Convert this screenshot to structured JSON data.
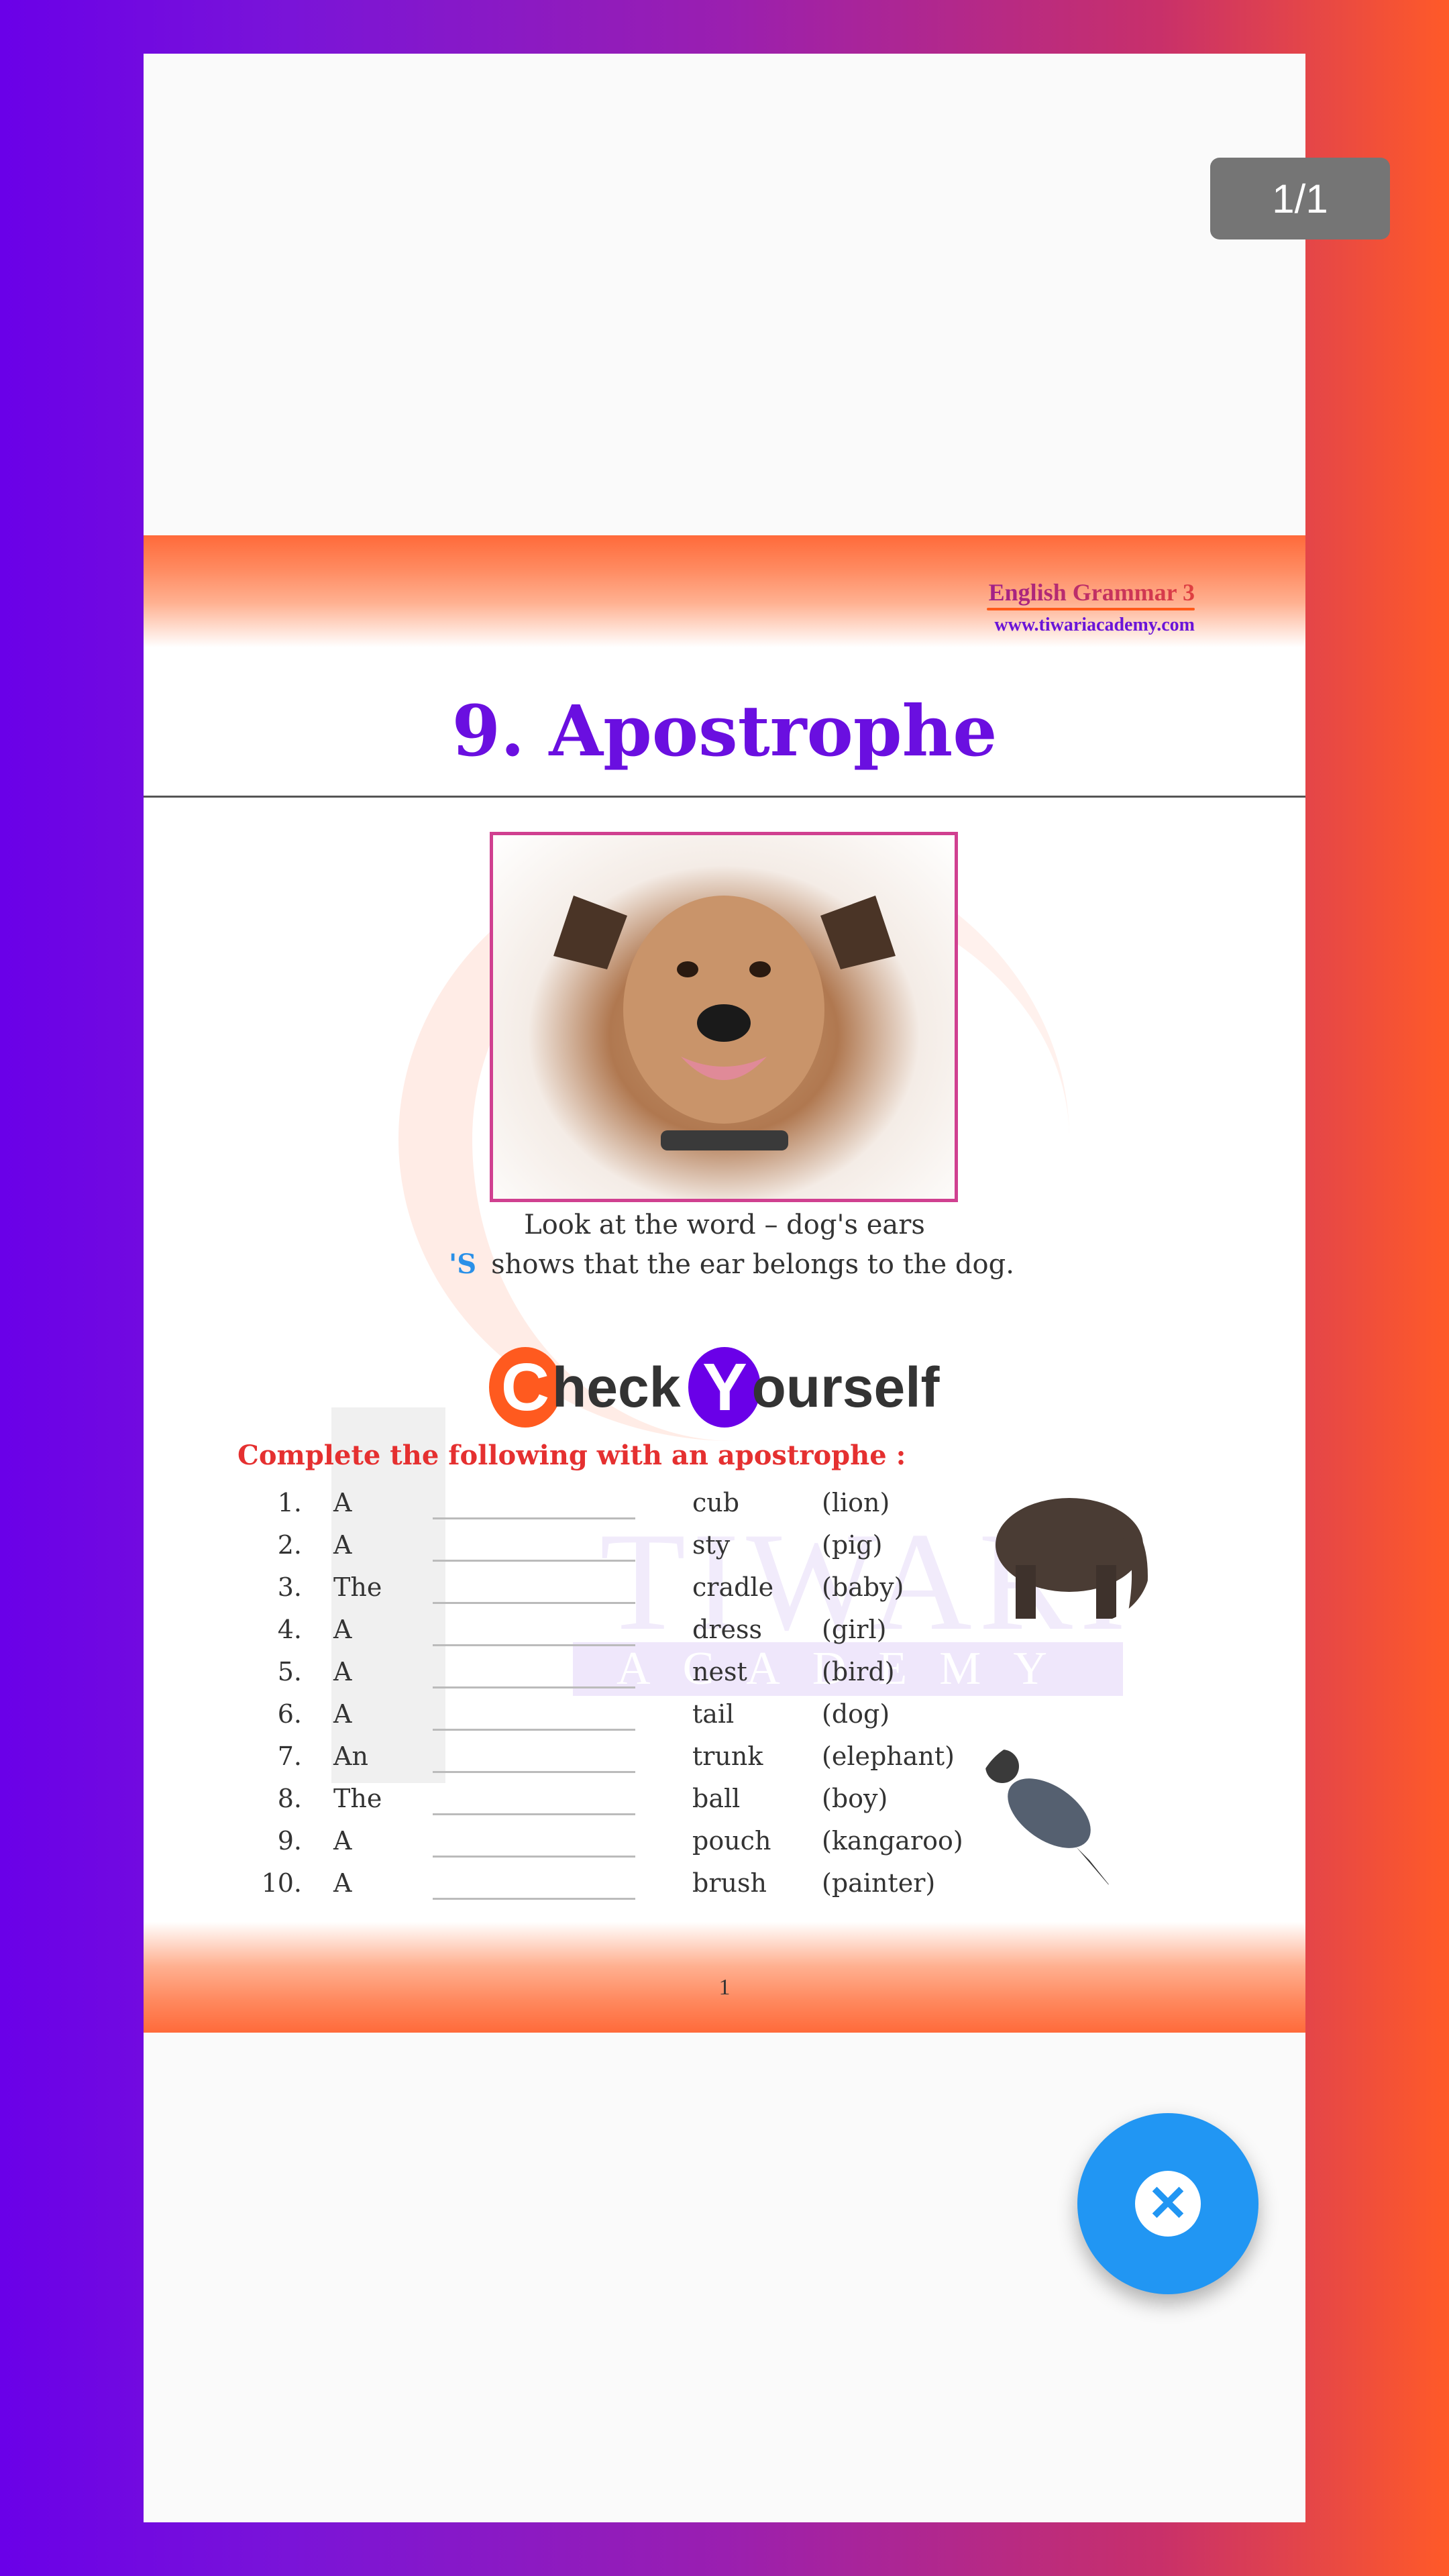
{
  "viewer": {
    "page_indicator": "1/1",
    "close_icon": "close-circle-icon"
  },
  "page": {
    "header": {
      "book": "English Grammar 3",
      "website": "www.tiwariacademy.com"
    },
    "title": "9. Apostrophe",
    "caption_line1": "Look at the word  –  dog's ears",
    "caption_marker": "'S",
    "caption_line2": "shows that the ear belongs to the dog.",
    "check_yourself": {
      "c": "C",
      "heck": "heck",
      "y": "Y",
      "ourself": "ourself"
    },
    "instruction": "Complete the following with an apostrophe :",
    "exercises": [
      {
        "num": "1.",
        "article": "A",
        "noun": "cub",
        "owner": "(lion)"
      },
      {
        "num": "2.",
        "article": "A",
        "noun": "sty",
        "owner": "(pig)"
      },
      {
        "num": "3.",
        "article": "The",
        "noun": "cradle",
        "owner": "(baby)"
      },
      {
        "num": "4.",
        "article": "A",
        "noun": "dress",
        "owner": "(girl)"
      },
      {
        "num": "5.",
        "article": "A",
        "noun": "nest",
        "owner": "(bird)"
      },
      {
        "num": "6.",
        "article": "A",
        "noun": "tail",
        "owner": "(dog)"
      },
      {
        "num": "7.",
        "article": "An",
        "noun": "trunk",
        "owner": "(elephant)"
      },
      {
        "num": "8.",
        "article": "The",
        "noun": "ball",
        "owner": "(boy)"
      },
      {
        "num": "9.",
        "article": "A",
        "noun": "pouch",
        "owner": "(kangaroo)"
      },
      {
        "num": "10.",
        "article": "A",
        "noun": "brush",
        "owner": "(painter)"
      }
    ],
    "watermark": {
      "main": "TIWARI",
      "sub": "ACADEMY"
    },
    "page_number": "1"
  },
  "colors": {
    "fab": "#2196f3",
    "title": "#6a0fe0",
    "instruction": "#e53030",
    "c_circle": "#ff5a1f",
    "y_circle": "#6a00e8"
  }
}
